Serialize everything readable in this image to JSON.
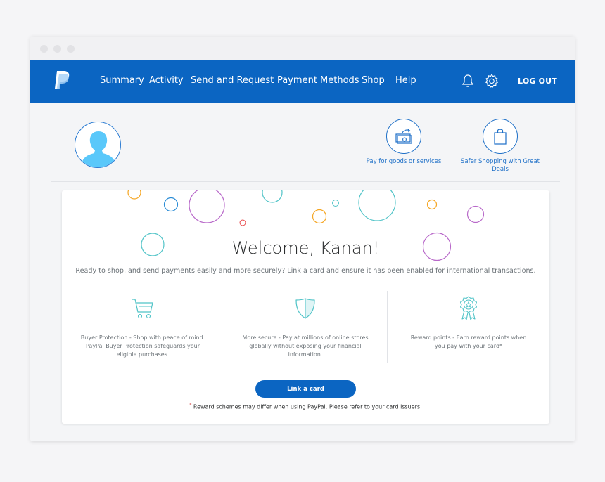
{
  "nav": {
    "items": [
      {
        "label": "Summary"
      },
      {
        "label": "Activity"
      },
      {
        "label": "Send and Request"
      },
      {
        "label": "Payment Methods"
      },
      {
        "label": "Shop"
      },
      {
        "label": "Help"
      }
    ],
    "logout_label": "LOG OUT",
    "icons": [
      "bell-icon",
      "settings-gear-icon"
    ]
  },
  "quick_actions": [
    {
      "label": "Pay for goods or services",
      "icon": "money-transfer-icon"
    },
    {
      "label": "Safer Shopping with Great Deals",
      "icon": "shopping-bag-icon"
    }
  ],
  "welcome": {
    "title": "Welcome, Kanan!",
    "subtitle": "Ready to shop, and send payments easily and more securely? Link a card and ensure it has been enabled for international transactions."
  },
  "features": [
    {
      "icon": "shopping-cart-icon",
      "lines": [
        "Buyer Protection - Shop with peace of mind.",
        "PayPal Buyer Protection safeguards your",
        "eligible purchases."
      ]
    },
    {
      "icon": "shield-icon",
      "lines": [
        "More secure - Pay at millions of online stores",
        "globally without exposing your financial",
        "information."
      ]
    },
    {
      "icon": "award-ribbon-icon",
      "lines": [
        "Reward points - Earn reward points when",
        "you pay with your card*"
      ]
    }
  ],
  "cta": {
    "label": "Link a card"
  },
  "footnote": {
    "marker": "*",
    "text": "Reward schemes may differ when using PayPal. Please refer to your card issuers."
  },
  "colors": {
    "brand_blue": "#0b65c2",
    "accent_teal": "#4fc3c7",
    "bubble_purple": "#b868c9",
    "bubble_orange": "#f5a623",
    "bubble_blue": "#2a8cd6"
  }
}
